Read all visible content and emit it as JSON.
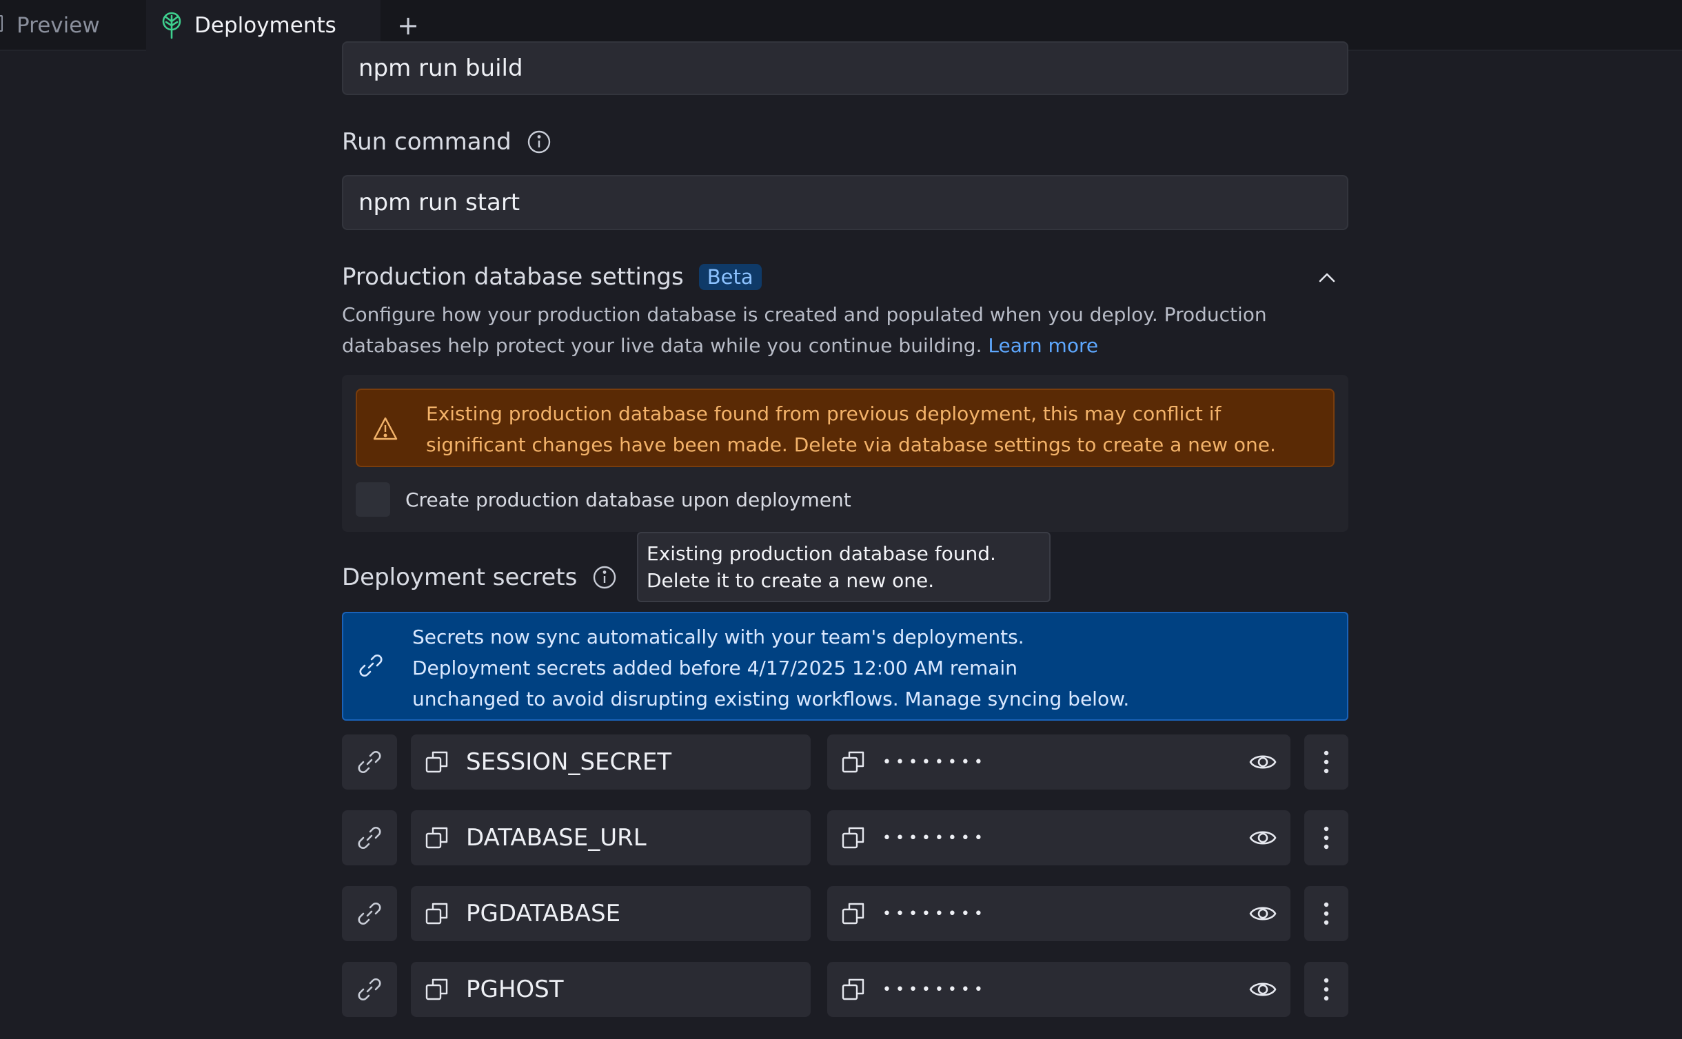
{
  "tabs": {
    "preview": "Preview",
    "deployments": "Deployments",
    "add": "+"
  },
  "build": {
    "value": "npm run build"
  },
  "run": {
    "label": "Run command",
    "value": "npm run start"
  },
  "prod_db": {
    "title": "Production database settings",
    "badge": "Beta",
    "description": "Configure how your production database is created and populated when you deploy. Production databases help protect your live data while you continue building.",
    "learn_more": "Learn more",
    "warning": "Existing production database found from previous deployment, this may conflict if significant changes have been made. Delete via database settings to create a new one.",
    "checkbox_label": "Create production database upon deployment",
    "checkbox_checked": false
  },
  "tooltip": {
    "line1": "Existing production database found.",
    "line2": "Delete it to create a new one."
  },
  "secrets": {
    "label": "Deployment secrets",
    "banner_line1": "Secrets now sync automatically with your team's deployments.",
    "banner_line2": "Deployment secrets added before 4/17/2025 12:00 AM remain",
    "banner_line3": "unchanged to avoid disrupting existing workflows. Manage syncing below.",
    "rows": [
      {
        "key": "SESSION_SECRET",
        "value": "••••••••"
      },
      {
        "key": "DATABASE_URL",
        "value": "••••••••"
      },
      {
        "key": "PGDATABASE",
        "value": "••••••••"
      },
      {
        "key": "PGHOST",
        "value": "••••••••"
      }
    ]
  },
  "colors": {
    "background": "#1c1d24",
    "accent_link": "#5ea8ff",
    "warning_bg": "#5a2a05",
    "warning_text": "#f3b36a",
    "banner_bg": "#004182",
    "badge_bg": "#0f3a68"
  },
  "icons": {
    "deployments_tab": "deploy-tree-icon",
    "info": "info-icon",
    "collapse": "chevron-up-icon",
    "warning": "warning-triangle-icon",
    "sync": "link-icon",
    "copy": "copy-icon",
    "reveal": "eye-icon",
    "menu": "more-vertical-icon"
  }
}
